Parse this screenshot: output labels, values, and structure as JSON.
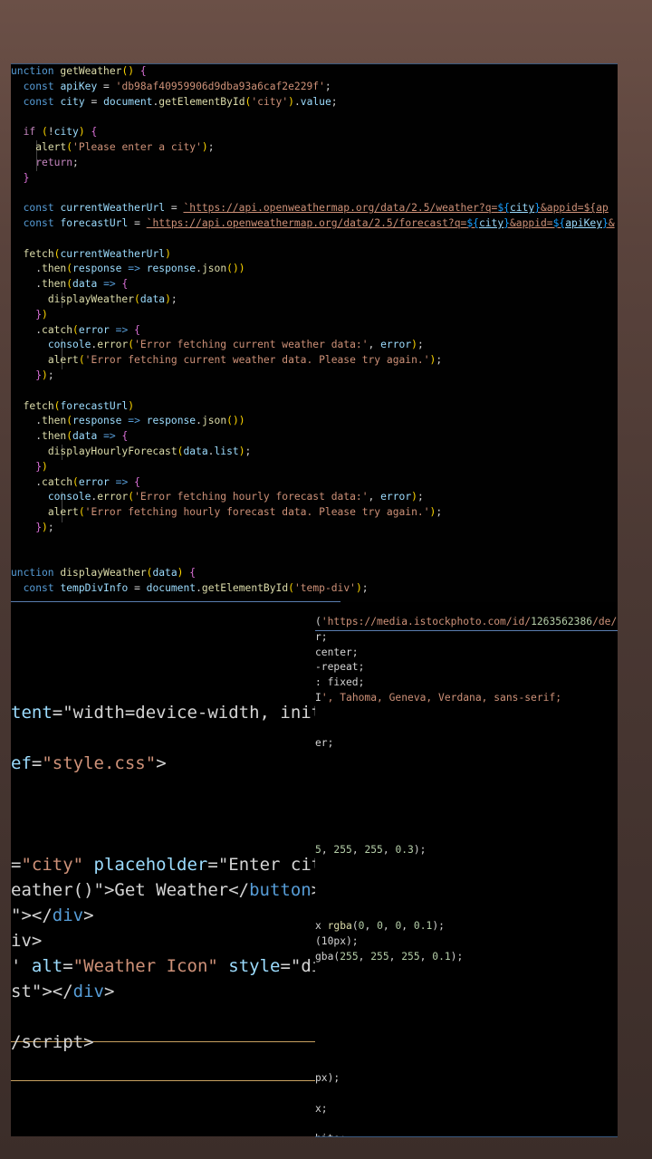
{
  "js_code": {
    "lines": [
      "unction getWeather() {",
      "  const apiKey = 'db98af40959906d9dba93a6caf2e229f';",
      "  const city = document.getElementById('city').value;",
      "",
      "  if (!city) {",
      "    alert('Please enter a city');",
      "    return;",
      "  }",
      "",
      "  const currentWeatherUrl = `https://api.openweathermap.org/data/2.5/weather?q=${city}&appid=${ap",
      "  const forecastUrl = `https://api.openweathermap.org/data/2.5/forecast?q=${city}&appid=${apiKey}&",
      "",
      "  fetch(currentWeatherUrl)",
      "    .then(response => response.json())",
      "    .then(data => {",
      "      displayWeather(data);",
      "    })",
      "    .catch(error => {",
      "      console.error('Error fetching current weather data:', error);",
      "      alert('Error fetching current weather data. Please try again.');",
      "    });",
      "",
      "  fetch(forecastUrl)",
      "    .then(response => response.json())",
      "    .then(data => {",
      "      displayHourlyForecast(data.list);",
      "    })",
      "    .catch(error => {",
      "      console.error('Error fetching hourly forecast data:', error);",
      "      alert('Error fetching hourly forecast data. Please try again.');",
      "    });",
      "",
      "",
      "unction displayWeather(data) {",
      "  const tempDivInfo = document.getElementById('temp-div');"
    ]
  },
  "html_code": {
    "lines": [
      "tent=\"width=device-width, init",
      "",
      "ef=\"style.css\">",
      "",
      "",
      "",
      "=\"city\" placeholder=\"Enter city",
      "eather()\">Get Weather</button>",
      "\"></div>",
      "iv>",
      "' alt=\"Weather Icon\" style=\"di",
      "st\"></div>",
      "",
      "/script>"
    ]
  },
  "css_code": {
    "lines": [
      "('https://media.istockphoto.com/id/1263562386/de/",
      "r;",
      "center;",
      "-repeat;",
      ": fixed;",
      "I', Tahoma, Geneva, Verdana, sans-serif;",
      "",
      "",
      "er;",
      "",
      "",
      "",
      "",
      "",
      "",
      "5, 255, 255, 0.3);",
      "",
      "",
      "",
      "",
      "x rgba(0, 0, 0, 0.1);",
      "(10px);",
      "gba(255, 255, 255, 0.1);",
      "",
      "",
      "",
      "",
      "",
      "",
      "",
      "px);",
      "",
      "x;",
      "",
      "hite;"
    ]
  }
}
